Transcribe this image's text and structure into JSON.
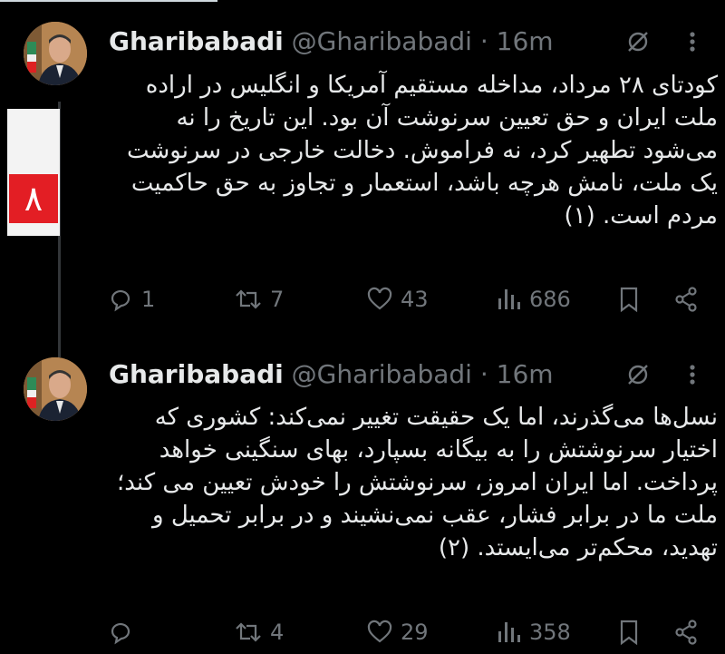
{
  "tweets": [
    {
      "name": "Gharibabadi",
      "handle": "@Gharibabadi",
      "separator": "·",
      "time": "16m",
      "text": "کودتای ۲۸ مرداد، مداخله مستقیم آمریکا و انگلیس در اراده ملت ایران و حق تعیین سرنوشت آن بود. این تاریخ را نه می‌شود تطهیر کرد، نه فراموش. دخالت خارجی در سرنوشت یک ملت، نامش هرچه باشد، استعمار و تجاوز به حق حاکمیت مردم است. (۱)",
      "replies": "1",
      "reposts": "7",
      "likes": "43",
      "views": "686"
    },
    {
      "name": "Gharibabadi",
      "handle": "@Gharibabadi",
      "separator": "·",
      "time": "16m",
      "text": "نسل‌ها می‌گذرند، اما یک حقیقت تغییر نمی‌کند: کشوری که اختیار سرنوشتش را به بیگانه بسپارد، بهای سنگینی خواهد پرداخت. اما ایران امروز، سرنوشتش را خودش تعیین می کند؛ ملت ما در برابر فشار، عقب نمی‌نشیند و در برابر تحمیل و تهدید، محکم‌تر می‌ایستد. (۲)",
      "replies": "",
      "reposts": "4",
      "likes": "29",
      "views": "358"
    }
  ],
  "icons": {
    "reply": "reply-icon",
    "repost": "repost-icon",
    "like": "heart-icon",
    "views": "views-icon",
    "bookmark": "bookmark-icon",
    "share": "share-icon",
    "grok": "grok-icon",
    "more": "more-icon"
  },
  "colors": {
    "background": "#000000",
    "text": "#e7e9ea",
    "muted": "#71767b",
    "badge_red": "#e31e24"
  }
}
